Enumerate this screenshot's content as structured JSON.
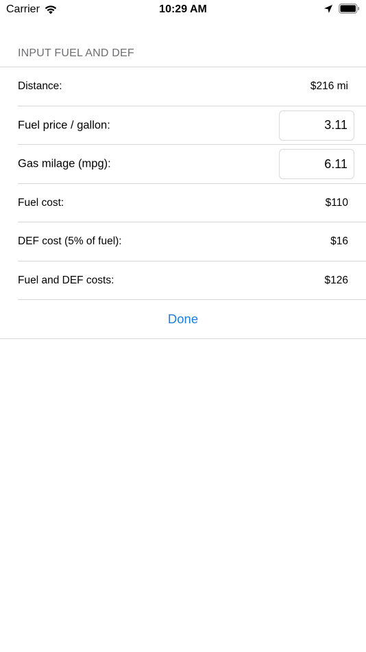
{
  "status_bar": {
    "carrier": "Carrier",
    "time": "10:29 AM",
    "icons": [
      "wifi-icon",
      "location-arrow-icon",
      "battery-icon"
    ]
  },
  "section": {
    "header": "INPUT FUEL AND DEF"
  },
  "rows": {
    "distance": {
      "label": "Distance:",
      "value": "$216 mi"
    },
    "fuel_price": {
      "label": "Fuel price / gallon:",
      "value": "3.11"
    },
    "gas_mileage": {
      "label": "Gas milage (mpg):",
      "value": "6.11"
    },
    "fuel_cost": {
      "label": "Fuel cost:",
      "value": "$110"
    },
    "def_cost": {
      "label": "DEF cost (5% of fuel):",
      "value": "$16"
    },
    "total_cost": {
      "label": "Fuel and DEF costs:",
      "value": "$126"
    }
  },
  "actions": {
    "done_label": "Done"
  },
  "colors": {
    "accent": "#1a7fe0",
    "section_header": "#6d6d72",
    "separator": "#d6d6d8"
  }
}
